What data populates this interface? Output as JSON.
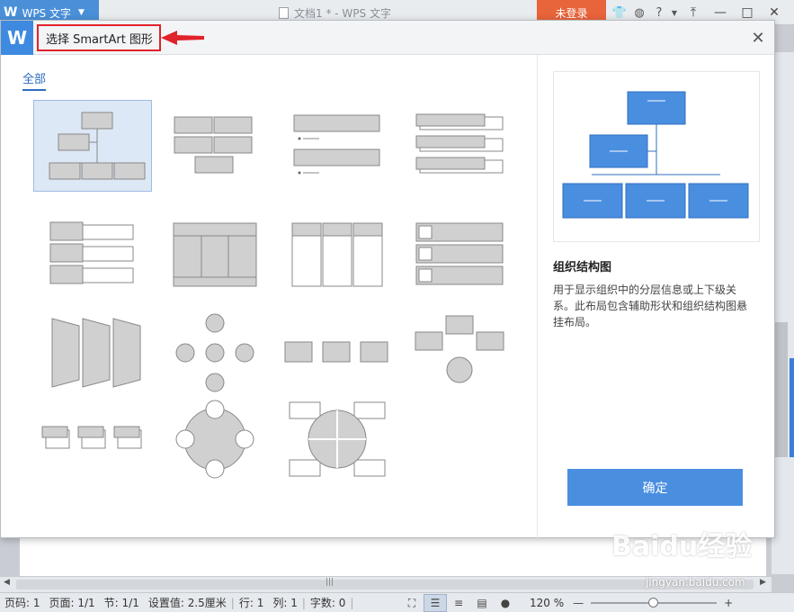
{
  "app": {
    "name": "WPS 文字",
    "doc_title": "文档1 * - WPS 文字",
    "login": "未登录"
  },
  "dialog": {
    "title": "选择 SmartArt 图形",
    "close": "✕",
    "category_tab": "全部",
    "selected_layout": {
      "name": "组织结构图",
      "description": "用于显示组织中的分层信息或上下级关系。此布局包含辅助形状和组织结构图悬挂布局。"
    },
    "ok_button": "确定"
  },
  "statusbar": {
    "page_code": "页码: 1",
    "page": "页面: 1/1",
    "section": "节: 1/1",
    "setting": "设置值: 2.5厘米",
    "row": "行: 1",
    "col": "列: 1",
    "words": "字数: 0",
    "zoom": "120 %"
  },
  "watermark": {
    "text": "Baidu经验",
    "sub": "jingyan.baidu.com"
  },
  "colors": {
    "accent": "#4a8ee0",
    "annotation": "#e0222a",
    "login": "#e8643a",
    "shape_fill": "#d0d0d0",
    "preview_fill": "#4a8ee0"
  }
}
